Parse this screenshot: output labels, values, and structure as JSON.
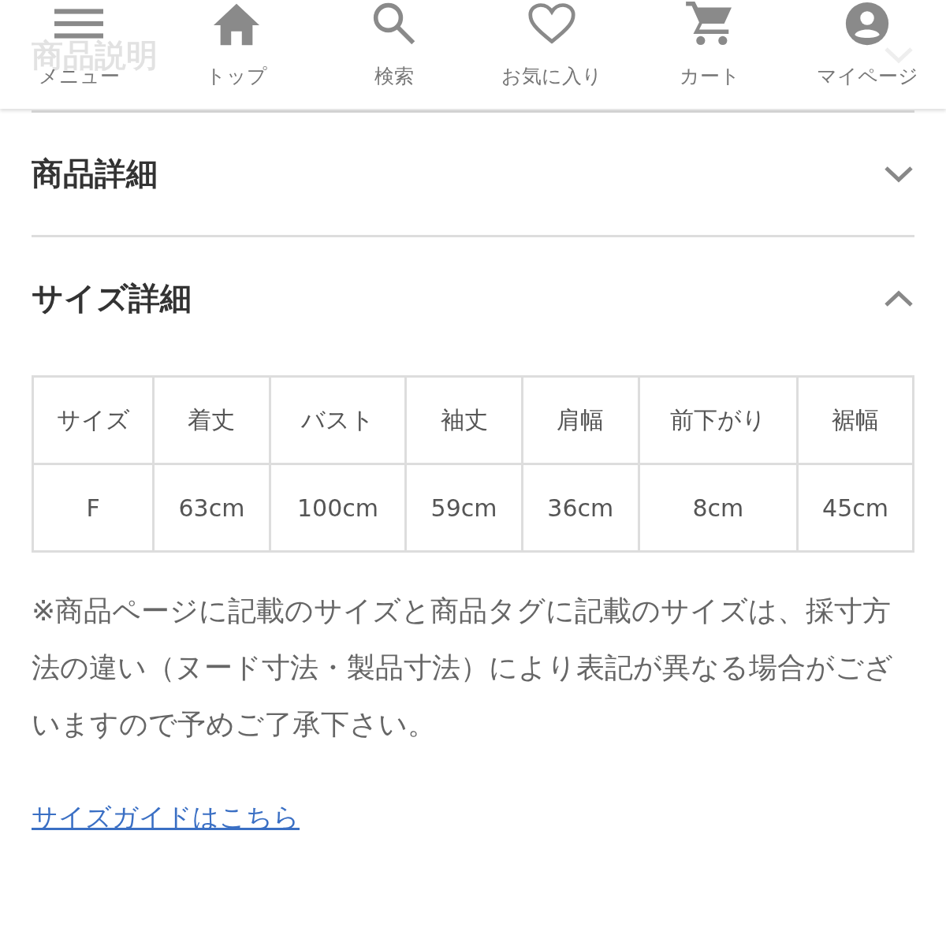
{
  "nav": [
    {
      "kind": "menu",
      "label": "メニュー"
    },
    {
      "kind": "home",
      "label": "トップ"
    },
    {
      "kind": "search",
      "label": "検索"
    },
    {
      "kind": "heart",
      "label": "お気に入り"
    },
    {
      "kind": "cart",
      "label": "カート"
    },
    {
      "kind": "user",
      "label": "マイページ"
    }
  ],
  "sections": [
    {
      "title": "商品説明",
      "expanded": false
    },
    {
      "title": "商品詳細",
      "expanded": false
    },
    {
      "title": "サイズ詳細",
      "expanded": true
    }
  ],
  "size_table": {
    "columns": [
      "サイズ",
      "着丈",
      "バスト",
      "袖丈",
      "肩幅",
      "前下がり",
      "裾幅"
    ],
    "rows": [
      [
        "F",
        "63cm",
        "100cm",
        "59cm",
        "36cm",
        "8cm",
        "45cm"
      ]
    ]
  },
  "note": "※商品ページに記載のサイズと商品タグに記載のサイズは、採寸方法の違い（ヌード寸法・製品寸法）により表記が異なる場合がございますので予めご了承下さい。",
  "size_guide_link": "サイズガイドはこちら"
}
